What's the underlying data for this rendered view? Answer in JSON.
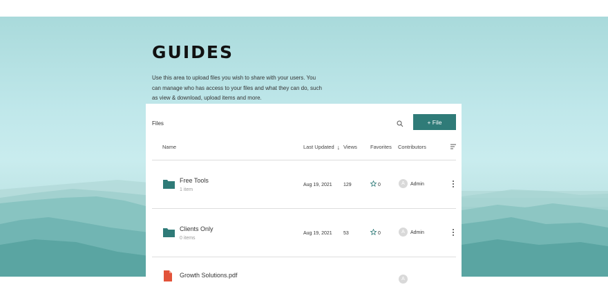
{
  "header": {
    "cut_text": "· · · · · · · · ·"
  },
  "page": {
    "title": "GUIDES",
    "description": "Use this area to upload files you wish to share with your users. You can manage who has access to your files and what they can do, such as view & download, upload items and more."
  },
  "files": {
    "label": "Files",
    "add_button": "+ File",
    "columns": {
      "name": "Name",
      "last_updated": "Last Updated",
      "views": "Views",
      "favorites": "Favorites",
      "contributors": "Contributors"
    },
    "rows": [
      {
        "name": "Free Tools",
        "meta": "1 item",
        "date": "Aug 19, 2021",
        "views": "129",
        "favorites": "0",
        "contributor_initial": "A",
        "contributor": "Admin",
        "type": "folder"
      },
      {
        "name": "Clients Only",
        "meta": "0 items",
        "date": "Aug 19, 2021",
        "views": "53",
        "favorites": "0",
        "contributor_initial": "A",
        "contributor": "Admin",
        "type": "folder"
      },
      {
        "name": "Growth Solutions.pdf",
        "meta": "",
        "date": "",
        "views": "",
        "favorites": "",
        "contributor_initial": "A",
        "contributor": "",
        "type": "pdf"
      }
    ]
  },
  "colors": {
    "accent": "#2f7b78",
    "folder": "#2f7b78",
    "pdf": "#e2533a"
  }
}
